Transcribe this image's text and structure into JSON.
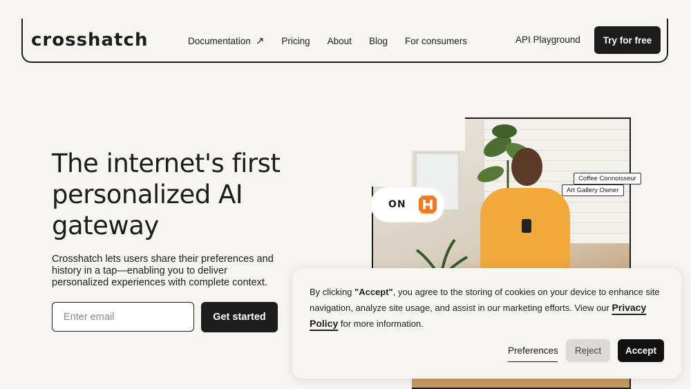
{
  "nav": {
    "logo": "crosshatch",
    "links": [
      {
        "label": "Documentation"
      },
      {
        "label": "Pricing"
      },
      {
        "label": "About"
      },
      {
        "label": "Blog"
      },
      {
        "label": "For consumers"
      }
    ],
    "api_playground": "API Playground",
    "try_button": "Try for free"
  },
  "hero": {
    "headline": "The internet's first personalized AI gateway",
    "subtext": "Crosshatch lets users share their preferences and history in a tap—enabling you to deliver personalized experiences with complete context.",
    "email_placeholder": "Enter email",
    "cta": "Get started",
    "toggle_label": "ON",
    "tags": [
      "Coffee Connoisseur",
      "Art Gallery Owner"
    ]
  },
  "cookie": {
    "text_prefix": "By clicking ",
    "text_bold": "\"Accept\"",
    "text_middle": ", you agree to the storing of cookies on your device to enhance site navigation, analyze site usage, and assist in our marketing efforts. View our ",
    "policy_link": "Privacy Policy",
    "text_suffix": " for more information.",
    "preferences": "Preferences",
    "reject": "Reject",
    "accept": "Accept"
  },
  "colors": {
    "background": "#f7f5ef",
    "dark": "#1c1c1c",
    "brand_orange": "#f47a20"
  }
}
